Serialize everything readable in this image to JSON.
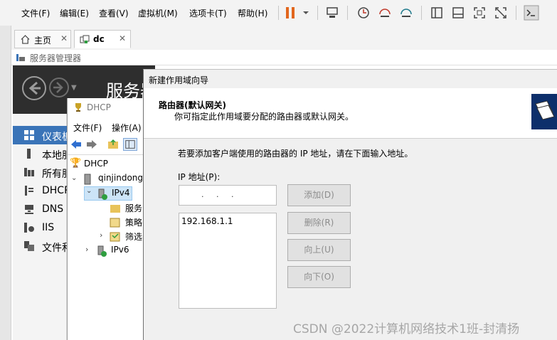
{
  "menubar": {
    "items": [
      "文件(F)",
      "编辑(E)",
      "查看(V)",
      "虚拟机(M)",
      "选项卡(T)",
      "帮助(H)"
    ]
  },
  "tabs": [
    {
      "label": "主页"
    },
    {
      "label": "dc"
    }
  ],
  "server_manager": {
    "window_title": "服务器管理器",
    "header_title": "服务器",
    "sidebar": [
      "仪表板",
      "本地服",
      "所有服",
      "DHCP",
      "DNS",
      "IIS",
      "文件和"
    ]
  },
  "dhcp_console": {
    "title": "DHCP",
    "menu": [
      "文件(F)",
      "操作(A)"
    ],
    "tree": {
      "root": "DHCP",
      "server": "qinjindong",
      "ipv4": "IPv4",
      "children": [
        "服务",
        "策略",
        "筛选"
      ],
      "ipv6": "IPv6"
    }
  },
  "wizard": {
    "title": "新建作用域向导",
    "heading": "路由器(默认网关)",
    "subheading": "你可指定此作用域要分配的路由器或默认网关。",
    "instruction": "若要添加客户端使用的路由器的 IP 地址，请在下面输入地址。",
    "ip_label": "IP 地址(P):",
    "ip_input_value": ".     .     .",
    "router_list": [
      "192.168.1.1"
    ],
    "buttons": {
      "add": "添加(D)",
      "remove": "删除(R)",
      "up": "向上(U)",
      "down": "向下(O)"
    }
  },
  "watermark": "CSDN @2022计算机网络技术1班-封清扬",
  "colors": {
    "accent_blue": "#3a74b8",
    "sm_header": "#2e2e2e",
    "pause_orange": "#e2661d"
  }
}
